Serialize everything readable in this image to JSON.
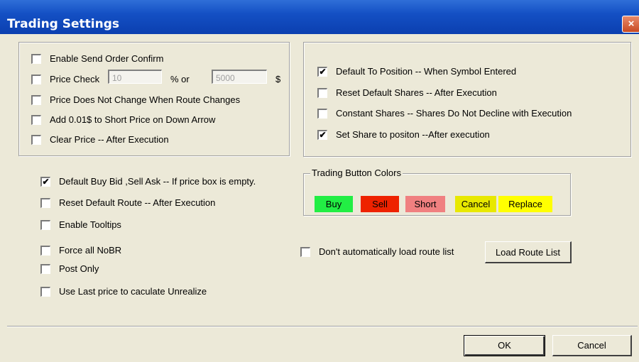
{
  "window": {
    "title": "Trading Settings",
    "close_glyph": "×"
  },
  "left_panel": {
    "enable_send_order_confirm": {
      "label": "Enable Send Order Confirm",
      "checked": false
    },
    "price_check": {
      "label": "Price Check",
      "value1": "10",
      "sep": "% or",
      "value2": "5000",
      "unit": "$",
      "checked": false
    },
    "price_not_change": {
      "label": "Price Does Not Change When Route Changes",
      "checked": false
    },
    "add_short_price": {
      "label": "Add 0.01$ to Short Price on Down Arrow",
      "checked": false
    },
    "clear_price": {
      "label": "Clear Price -- After Execution",
      "checked": false
    }
  },
  "right_panel": {
    "default_to_position": {
      "label": "Default To Position -- When Symbol Entered",
      "checked": true
    },
    "reset_default_shares": {
      "label": "Reset Default Shares -- After Execution",
      "checked": false
    },
    "constant_shares": {
      "label": "Constant Shares -- Shares Do Not Decline with Execution",
      "checked": false
    },
    "set_share_position": {
      "label": "Set Share to positon --After execution",
      "checked": true
    }
  },
  "lower_left": {
    "default_buy_bid": {
      "label": "Default Buy Bid ,Sell Ask -- If price box is empty.",
      "checked": true
    },
    "reset_default_route": {
      "label": "Reset Default Route -- After Execution",
      "checked": false
    },
    "enable_tooltips": {
      "label": "Enable Tooltips",
      "checked": false
    },
    "force_all_nobr": {
      "label": "Force all NoBR",
      "checked": false
    },
    "post_only": {
      "label": "Post Only",
      "checked": false
    },
    "use_last_price": {
      "label": "Use Last price to caculate Unrealize",
      "checked": false
    }
  },
  "button_colors": {
    "legend": "Trading Button Colors",
    "buy": {
      "label": "Buy",
      "color": "#22ee44"
    },
    "sell": {
      "label": "Sell",
      "color": "#ee2200"
    },
    "short": {
      "label": "Short",
      "color": "#f08080"
    },
    "cancel": {
      "label": "Cancel",
      "color": "#e8e800"
    },
    "replace": {
      "label": "Replace",
      "color": "#ffff00"
    }
  },
  "route": {
    "dont_auto_load": {
      "label": "Don't automatically load route list",
      "checked": false
    },
    "load_button": "Load Route List"
  },
  "footer": {
    "ok": "OK",
    "cancel": "Cancel"
  },
  "check_glyph": "✔"
}
